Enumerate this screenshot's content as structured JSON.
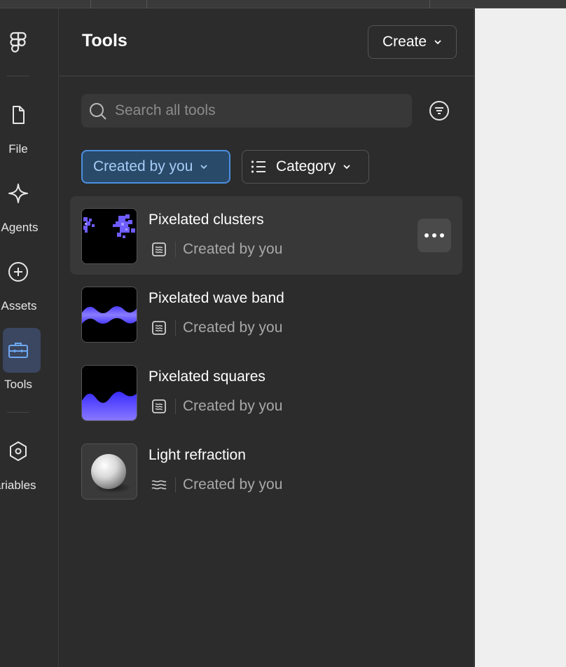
{
  "rail": {
    "items": [
      {
        "label": "File",
        "icon": "file-icon"
      },
      {
        "label": "Agents",
        "icon": "sparkle-icon"
      },
      {
        "label": "Assets",
        "icon": "plus-circle-icon"
      },
      {
        "label": "Tools",
        "icon": "toolbox-icon",
        "active": true
      },
      {
        "label": "ariables",
        "icon": "hexagon-icon"
      }
    ]
  },
  "panel": {
    "title": "Tools",
    "create_label": "Create"
  },
  "search": {
    "placeholder": "Search all tools"
  },
  "filters": {
    "created_label": "Created by you",
    "category_label": "Category"
  },
  "tools": [
    {
      "name": "Pixelated clusters",
      "by": "Created by you",
      "type_icon": "shader-icon"
    },
    {
      "name": "Pixelated wave band",
      "by": "Created by you",
      "type_icon": "shader-icon"
    },
    {
      "name": "Pixelated squares",
      "by": "Created by you",
      "type_icon": "shader-icon"
    },
    {
      "name": "Light refraction",
      "by": "Created by you",
      "type_icon": "wave-icon"
    }
  ],
  "colors": {
    "accent": "#4a8fe0",
    "chip_bg": "#2a4a6a",
    "thumb_purple": "#6e5cff"
  }
}
